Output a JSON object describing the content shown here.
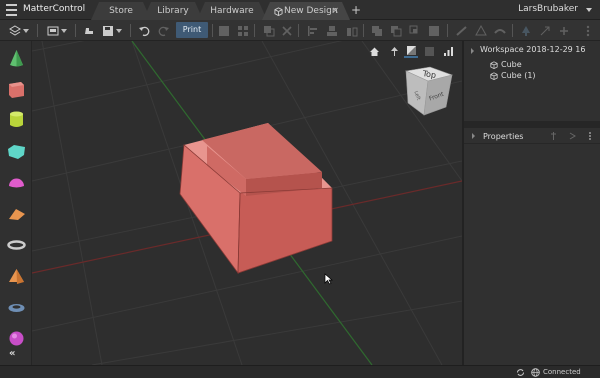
{
  "app": {
    "name": "MatterControl",
    "user": "LarsBrubaker"
  },
  "tabs": [
    {
      "label": "Store",
      "active": false
    },
    {
      "label": "Library",
      "active": false
    },
    {
      "label": "Hardware",
      "active": false
    },
    {
      "label": "New Design",
      "active": true,
      "close": "×"
    }
  ],
  "add_tab": "+",
  "toolbar": {
    "print_label": "Print"
  },
  "left_tools": [
    "cone",
    "cube",
    "cylinder",
    "wedge",
    "half-sphere",
    "pyramid",
    "torus",
    "triangle-prism",
    "ring",
    "sphere"
  ],
  "left_collapse": "«",
  "viewport": {
    "view_cube_top": "Top",
    "view_cube_front": "Front",
    "view_cube_left": "Left"
  },
  "workspace": {
    "title": "Workspace 2018-12-29 16",
    "items": [
      "Cube",
      "Cube (1)"
    ]
  },
  "properties": {
    "title": "Properties"
  },
  "status": {
    "connection": "Connected"
  },
  "colors": {
    "accent": "#3f5a75",
    "object": "#d9706a",
    "background": "#2b2b2b"
  }
}
